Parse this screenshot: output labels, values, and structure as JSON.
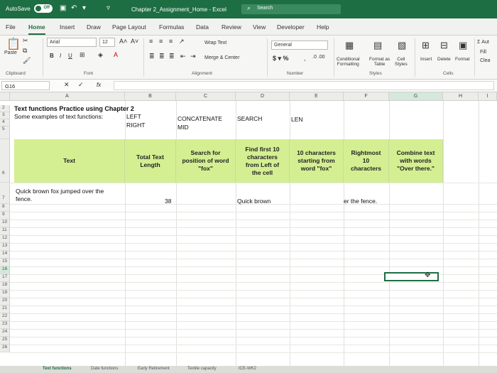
{
  "titlebar": {
    "autosave_label": "AutoSave",
    "autosave_state": "Off",
    "doc_title": "Chapter 2_Assignment_Home  -  Excel",
    "search_label": "Search"
  },
  "tabs": [
    "File",
    "Home",
    "Insert",
    "Draw",
    "Page Layout",
    "Formulas",
    "Data",
    "Review",
    "View",
    "Developer",
    "Help"
  ],
  "active_tab": "Home",
  "ribbon": {
    "paste_label": "Paste",
    "font_name": "Arial",
    "font_size": "12",
    "bold": "B",
    "italic": "I",
    "underline": "U",
    "wrap_text": "Wrap Text",
    "merge_center": "Merge & Center",
    "number_format": "General",
    "conditional": "Conditional\nFormatting",
    "format_as_table": "Format as\nTable",
    "cell_styles": "Cell\nStyles",
    "insert": "Insert",
    "delete": "Delete",
    "format": "Format",
    "autosum": "Σ Aut",
    "fill": "Fill",
    "clear": "Clea",
    "groups": {
      "clipboard": "Clipboard",
      "font": "Font",
      "alignment": "Alignment",
      "number": "Number",
      "styles": "Styles",
      "cells": "Cells"
    }
  },
  "formula_bar": {
    "name_box": "G16",
    "fx": "fx",
    "value": ""
  },
  "columns": [
    "A",
    "B",
    "C",
    "D",
    "E",
    "F",
    "G",
    "H",
    "I"
  ],
  "selected_column": "G",
  "rows": [
    "2",
    "3",
    "4",
    "5",
    "6",
    "7",
    "8",
    "9",
    "10",
    "11",
    "12",
    "13",
    "14",
    "15",
    "16",
    "17",
    "18",
    "19",
    "20",
    "21",
    "22",
    "23",
    "24",
    "25",
    "26"
  ],
  "selected_row": "16",
  "cells": {
    "a2": "Text functions Practice using Chapter 2",
    "a3": "Some examples of text functions:",
    "b3": "LEFT",
    "b4": "RIGHT",
    "c3": "CONCATENATE",
    "c4": "MID",
    "d3": "SEARCH",
    "e3": "LEN",
    "a7_line1": "Quick brown fox jumped over the",
    "a7_line2": "fence.",
    "b7": "38",
    "d7": "Quick brown",
    "f7": "er the fence."
  },
  "table_headers": [
    "Text",
    "Total Text\nLength",
    "Search for\nposition of word\n\"fox\"",
    "Find first 10\ncharacters\nfrom Left of\nthe cell",
    "10 characters\nstarting from\nword \"fox\"",
    "Rightmost\n10\ncharacters",
    "Combine text\nwith words\n\"Over there.\""
  ],
  "header_fill_color": "#d4ef92",
  "accent_color": "#1e6e43",
  "sheet_tabs": [
    "Text functions",
    "Date functions",
    "Early Retirement",
    "Textile capacity",
    "ICE-WK2"
  ]
}
